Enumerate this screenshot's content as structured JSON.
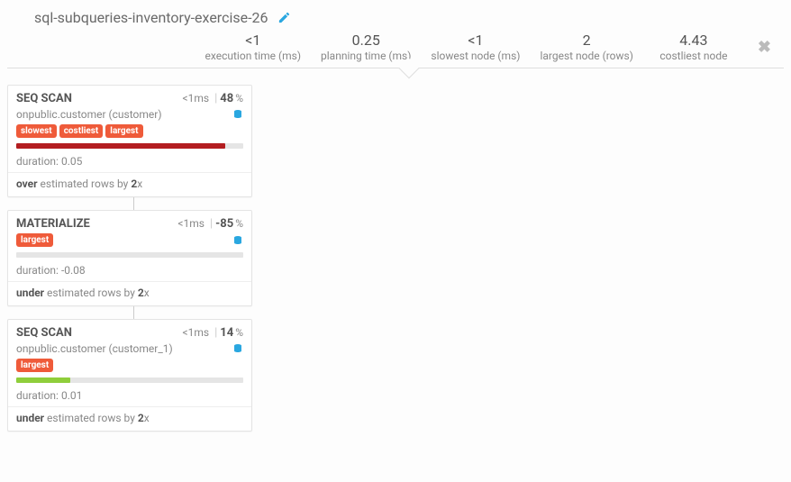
{
  "header": {
    "title": "sql-subqueries-inventory-exercise-26"
  },
  "stats": {
    "execution_time": {
      "value": "<1",
      "label": "execution time (ms)"
    },
    "planning_time": {
      "value": "0.25",
      "label": "planning time (ms)"
    },
    "slowest_node": {
      "value": "<1",
      "label": "slowest node (ms)"
    },
    "largest_node": {
      "value": "2",
      "label": "largest node (rows)"
    },
    "costliest_node": {
      "value": "4.43",
      "label": "costliest node"
    }
  },
  "nodes": [
    {
      "title": "SEQ SCAN",
      "time": "<1",
      "time_unit": "ms",
      "pct": "48",
      "pct_unit": "%",
      "relation_prefix": "on ",
      "relation": "public.customer (customer)",
      "tags": [
        "slowest",
        "costliest",
        "largest"
      ],
      "bar_color": "bar-red",
      "bar_width": "92%",
      "duration_label": "duration: ",
      "duration": "0.05",
      "est_dir": "over",
      "est_mid": " estimated rows by ",
      "est_factor": "2",
      "est_suffix": "x"
    },
    {
      "title": "MATERIALIZE",
      "time": "<1",
      "time_unit": "ms",
      "pct": "-85",
      "pct_unit": "%",
      "relation_prefix": "",
      "relation": "",
      "tags": [
        "largest"
      ],
      "bar_color": "bar-empty",
      "bar_width": "0%",
      "duration_label": "duration: ",
      "duration": "-0.08",
      "est_dir": "under",
      "est_mid": " estimated rows by ",
      "est_factor": "2",
      "est_suffix": "x"
    },
    {
      "title": "SEQ SCAN",
      "time": "<1",
      "time_unit": "ms",
      "pct": "14",
      "pct_unit": "%",
      "relation_prefix": "on ",
      "relation": "public.customer (customer_1)",
      "tags": [
        "largest"
      ],
      "bar_color": "bar-green",
      "bar_width": "24%",
      "duration_label": "duration: ",
      "duration": "0.01",
      "est_dir": "under",
      "est_mid": " estimated rows by ",
      "est_factor": "2",
      "est_suffix": "x"
    }
  ]
}
